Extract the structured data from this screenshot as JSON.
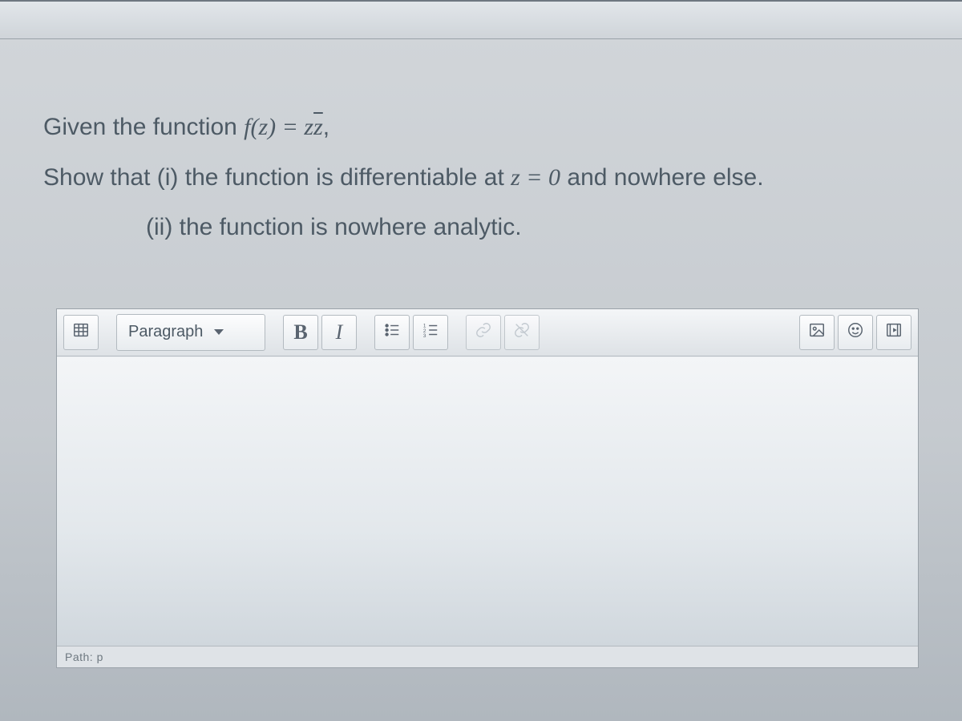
{
  "question": {
    "line1_prefix": "Given the function ",
    "line1_math_fz": "f(z) = z",
    "line1_math_zbar": "z",
    "line1_suffix": ",",
    "line2_prefix": "Show that (i) the function is differentiable at ",
    "line2_math": "z = 0",
    "line2_suffix": " and nowhere else.",
    "line3": "(ii) the function is nowhere analytic."
  },
  "toolbar": {
    "format_label": "Paragraph",
    "bold_label": "B",
    "italic_label": "I"
  },
  "status": {
    "path_label": "Path: p"
  },
  "icons": {
    "table": "table-icon",
    "bullet": "bullet-list-icon",
    "numbered": "numbered-list-icon",
    "link": "link-icon",
    "unlink": "unlink-icon",
    "image": "image-icon",
    "smiley": "smiley-icon",
    "media": "media-icon"
  }
}
